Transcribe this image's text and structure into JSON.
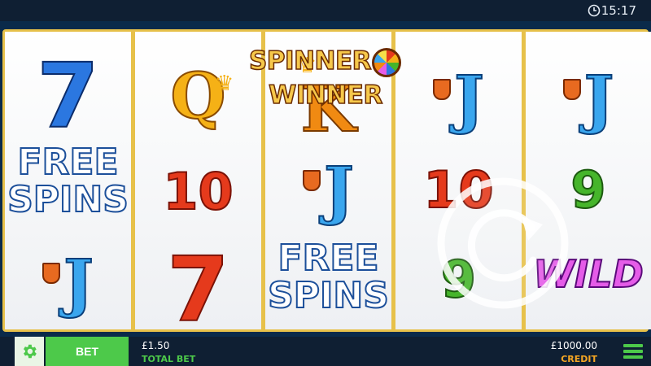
{
  "status_bar": {
    "time": "15:17",
    "clock_icon": "clock-icon"
  },
  "game": {
    "logo_parts": [
      "SPINNER",
      "WINNER"
    ],
    "reels": [
      {
        "symbols": [
          "7",
          "FREE SPINS",
          "J"
        ]
      },
      {
        "symbols": [
          "Q",
          "10",
          "7"
        ]
      },
      {
        "symbols": [
          "K",
          "J",
          "FREE SPINS"
        ]
      },
      {
        "symbols": [
          "J",
          "10",
          "9"
        ]
      },
      {
        "symbols": [
          "J",
          "9",
          "WILD"
        ]
      }
    ],
    "labels": {
      "free": "FREE",
      "spins": "SPINS",
      "wild": "WILD",
      "seven": "7",
      "ten": "10",
      "nine": "9",
      "q": "Q",
      "k": "K",
      "j": "J"
    },
    "colors": {
      "frame": "#e7c14a",
      "accent": "#4dc94a",
      "credit_label": "#f5a623",
      "bar": "#0f1f33"
    }
  },
  "bottom_bar": {
    "settings_icon": "gear-icon",
    "bet_label": "BET",
    "total_bet_value": "£1.50",
    "total_bet_label": "TOTAL BET",
    "credit_value": "£1000.00",
    "credit_label": "CREDIT",
    "menu_icon": "hamburger-menu-icon"
  }
}
